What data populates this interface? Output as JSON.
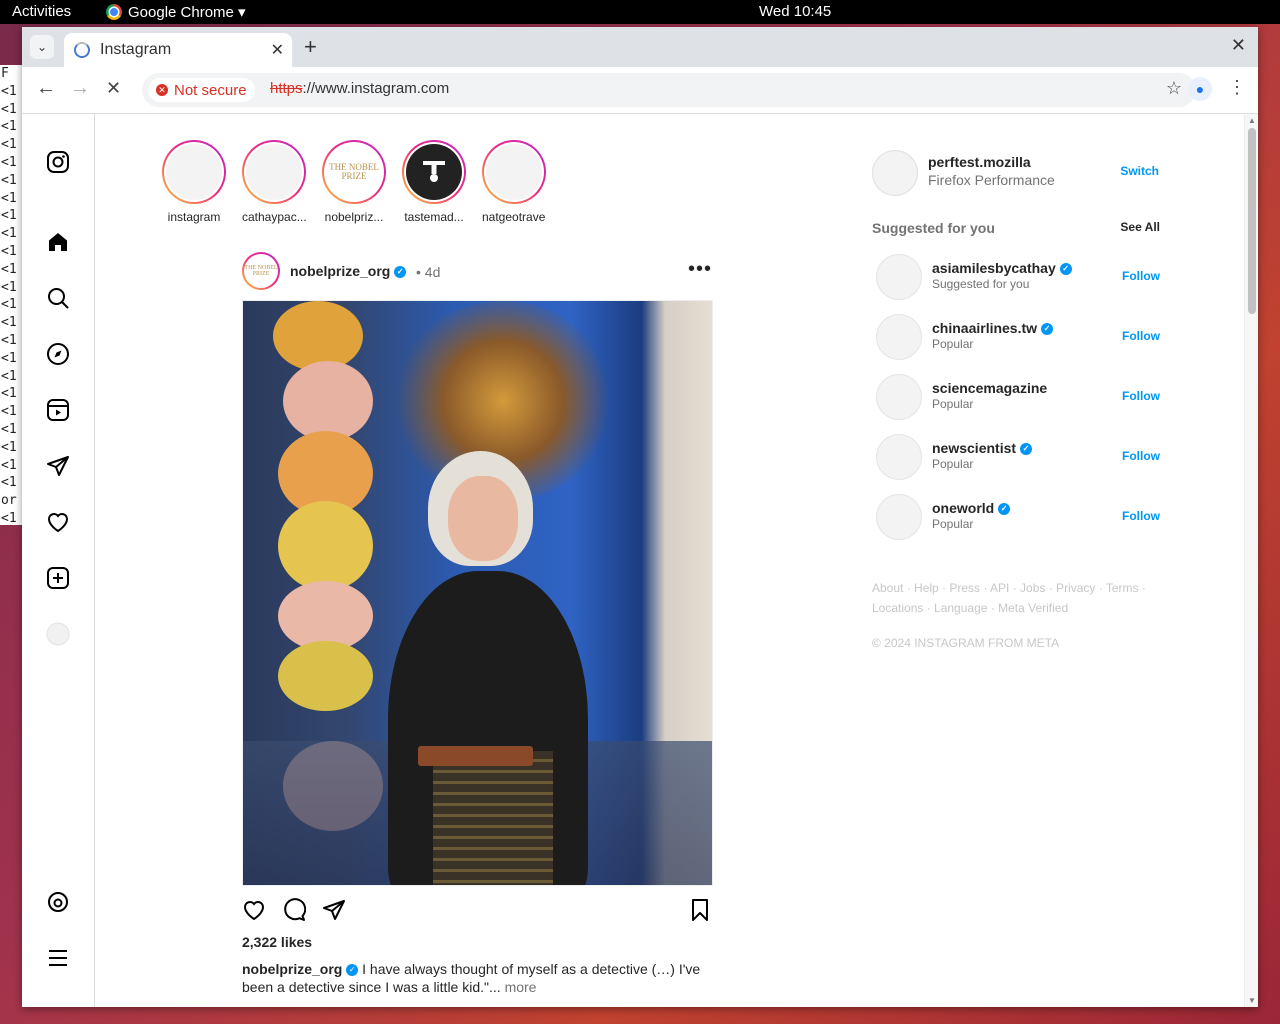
{
  "topbar": {
    "activities": "Activities",
    "app": "Google Chrome ▾",
    "clock": "Wed 10:45"
  },
  "terminal_lines": [
    "F",
    "<1",
    "<1",
    "<1",
    "<1",
    "<1",
    "<1",
    "<1",
    "<1",
    "<1",
    "<1",
    "<1",
    "<1",
    "<1",
    "<1",
    "<1",
    "<1",
    "<1",
    "<1",
    "<1",
    "<1",
    "<1",
    "<1",
    "<1",
    "or",
    "<1"
  ],
  "browser": {
    "tab_title": "Instagram",
    "security_chip": "Not secure",
    "url_scheme": "https",
    "url_rest": "://www.instagram.com"
  },
  "nav_icons": [
    "instagram-logo-icon",
    "home-icon",
    "search-icon",
    "explore-icon",
    "reels-icon",
    "messages-icon",
    "notifications-icon",
    "create-icon",
    "profile-icon",
    "threads-icon",
    "menu-icon"
  ],
  "stories": [
    {
      "name": "instagram"
    },
    {
      "name": "cathaypac..."
    },
    {
      "name": "nobelpriz..."
    },
    {
      "name": "tastemad..."
    },
    {
      "name": "natgeotravel"
    }
  ],
  "nobel_logo_text": "THE NOBEL PRIZE",
  "post": {
    "user": "nobelprize_org",
    "time": "• 4d",
    "likes": "2,322 likes",
    "caption_user": "nobelprize_org",
    "caption_text": " I have always thought of myself as a detective (…) I've been a detective since I was a little kid.\"...",
    "more": "more"
  },
  "sidebar": {
    "me_user": "perftest.mozilla",
    "me_name": "Firefox Performance",
    "switch": "Switch",
    "suggested_title": "Suggested for you",
    "see_all": "See All",
    "suggestions": [
      {
        "user": "asiamilesbycathay",
        "sub": "Suggested for you",
        "verified": true,
        "action": "Follow"
      },
      {
        "user": "chinaairlines.tw",
        "sub": "Popular",
        "verified": true,
        "action": "Follow"
      },
      {
        "user": "sciencemagazine",
        "sub": "Popular",
        "verified": false,
        "action": "Follow"
      },
      {
        "user": "newscientist",
        "sub": "Popular",
        "verified": true,
        "action": "Follow"
      },
      {
        "user": "oneworld",
        "sub": "Popular",
        "verified": true,
        "action": "Follow"
      }
    ],
    "footer_line1": "About · Help · Press · API · Jobs · Privacy · Terms ·",
    "footer_line2": "Locations · Language · Meta Verified",
    "copyright": "© 2024 INSTAGRAM FROM META"
  },
  "colors": {
    "accent": "#0095f6",
    "danger": "#d93025"
  }
}
